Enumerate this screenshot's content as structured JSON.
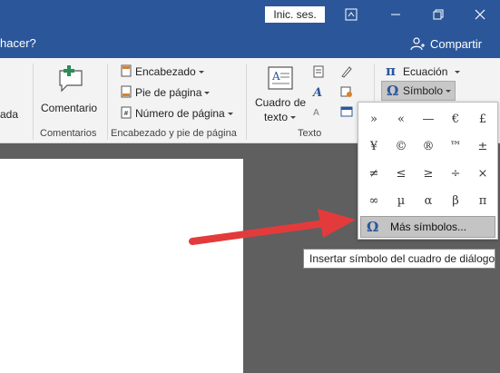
{
  "titlebar": {
    "signin_label": "Inic. ses.",
    "bg_color": "#2b579a"
  },
  "tellme": {
    "text": "¿Qué desea hacer?",
    "visible_text": "hacer?",
    "share_label": "Compartir"
  },
  "ribbon": {
    "partial_label": "ada",
    "comment_label": "Comentario",
    "comments_group": "Comentarios",
    "header_items": [
      "Encabezado",
      "Pie de página",
      "Número de página"
    ],
    "header_group": "Encabezado y pie de página",
    "textbox_label_1": "Cuadro de",
    "textbox_label_2": "texto",
    "text_group": "Texto",
    "equation_label": "Ecuación",
    "symbol_label": "Símbolo"
  },
  "symbols": {
    "grid": [
      "»",
      "«",
      "—",
      "€",
      "£",
      "¥",
      "©",
      "®",
      "™",
      "±",
      "≠",
      "≤",
      "≥",
      "÷",
      "×",
      "∞",
      "µ",
      "α",
      "β",
      "π"
    ],
    "more_label": "Más símbolos...",
    "tooltip": "Insertar símbolo del cuadro de diálogo"
  },
  "colors": {
    "word_blue": "#2b579a",
    "arrow_red": "#e33b3b"
  }
}
